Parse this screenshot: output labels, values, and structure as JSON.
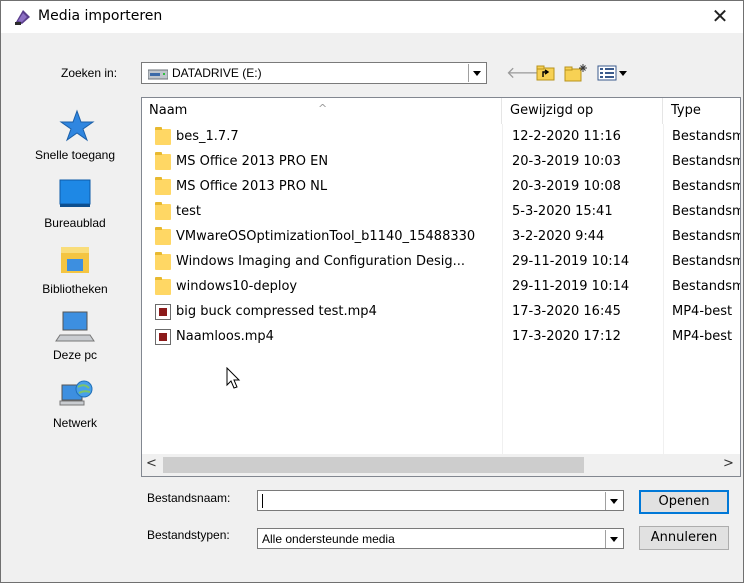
{
  "dialog": {
    "title": "Media importeren",
    "close_glyph": "✕"
  },
  "look_in": {
    "label": "Zoeken in:",
    "value": "DATADRIVE (E:)"
  },
  "toolbar": {
    "back_glyph": "🡐",
    "icons": [
      "back-arrow-icon",
      "up-folder-icon",
      "new-folder-icon",
      "view-menu-icon"
    ]
  },
  "places": [
    {
      "label": "Snelle toegang",
      "icon": "star-icon"
    },
    {
      "label": "Bureaublad",
      "icon": "desktop-icon"
    },
    {
      "label": "Bibliotheken",
      "icon": "libraries-icon"
    },
    {
      "label": "Deze pc",
      "icon": "computer-icon"
    },
    {
      "label": "Netwerk",
      "icon": "network-icon"
    }
  ],
  "columns": {
    "name": "Naam",
    "modified": "Gewijzigd op",
    "type": "Type"
  },
  "files": [
    {
      "name": "bes_1.7.7",
      "modified": "12-2-2020 11:16",
      "type": "Bestandsm",
      "kind": "folder"
    },
    {
      "name": "MS Office 2013 PRO EN",
      "modified": "20-3-2019 10:03",
      "type": "Bestandsm",
      "kind": "folder"
    },
    {
      "name": "MS Office 2013 PRO NL",
      "modified": "20-3-2019 10:08",
      "type": "Bestandsm",
      "kind": "folder"
    },
    {
      "name": "test",
      "modified": "5-3-2020 15:41",
      "type": "Bestandsm",
      "kind": "folder"
    },
    {
      "name": "VMwareOSOptimizationTool_b1140_15488330",
      "modified": "3-2-2020 9:44",
      "type": "Bestandsm",
      "kind": "folder"
    },
    {
      "name": "Windows Imaging and Configuration Desig...",
      "modified": "29-11-2019 10:14",
      "type": "Bestandsm",
      "kind": "folder"
    },
    {
      "name": "windows10-deploy",
      "modified": "29-11-2019 10:14",
      "type": "Bestandsm",
      "kind": "folder"
    },
    {
      "name": "big buck compressed test.mp4",
      "modified": "17-3-2020 16:45",
      "type": "MP4-best",
      "kind": "video"
    },
    {
      "name": "Naamloos.mp4",
      "modified": "17-3-2020 17:12",
      "type": "MP4-best",
      "kind": "video"
    }
  ],
  "filename": {
    "label": "Bestandsnaam:",
    "value": ""
  },
  "filetype": {
    "label": "Bestandstypen:",
    "value": "Alle ondersteunde media"
  },
  "buttons": {
    "open": "Openen",
    "cancel": "Annuleren"
  },
  "scroll": {
    "left": "<",
    "right": ">"
  }
}
